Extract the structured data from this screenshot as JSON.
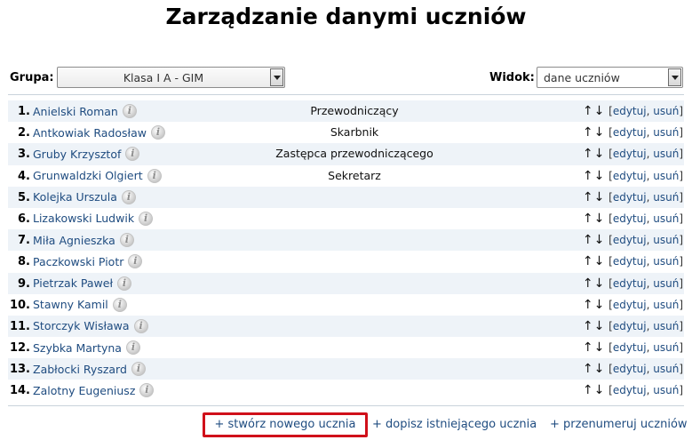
{
  "page": {
    "title": "Zarządzanie danymi uczniów"
  },
  "filters": {
    "group_label": "Grupa:",
    "group_value": "Klasa I A - GIM",
    "view_label": "Widok:",
    "view_value": "dane uczniów"
  },
  "row_actions": {
    "up": "↑",
    "down": "↓",
    "edit": "edytuj",
    "delete": "usuń",
    "separator": ",",
    "open_bracket": "[",
    "close_bracket": "]"
  },
  "info_icon_glyph": "i",
  "students": [
    {
      "num": "1.",
      "name": "Anielski Roman",
      "role": "Przewodniczący"
    },
    {
      "num": "2.",
      "name": "Antkowiak Radosław",
      "role": "Skarbnik"
    },
    {
      "num": "3.",
      "name": "Gruby Krzysztof",
      "role": "Zastępca przewodniczącego"
    },
    {
      "num": "4.",
      "name": "Grunwaldzki Olgiert",
      "role": "Sekretarz"
    },
    {
      "num": "5.",
      "name": "Kolejka Urszula",
      "role": ""
    },
    {
      "num": "6.",
      "name": "Lizakowski Ludwik",
      "role": ""
    },
    {
      "num": "7.",
      "name": "Miła Agnieszka",
      "role": ""
    },
    {
      "num": "8.",
      "name": "Paczkowski Piotr",
      "role": ""
    },
    {
      "num": "9.",
      "name": "Pietrzak Paweł",
      "role": ""
    },
    {
      "num": "10.",
      "name": "Stawny Kamil",
      "role": ""
    },
    {
      "num": "11.",
      "name": "Storczyk Wisława",
      "role": ""
    },
    {
      "num": "12.",
      "name": "Szybka Martyna",
      "role": ""
    },
    {
      "num": "13.",
      "name": "Zabłocki Ryszard",
      "role": ""
    },
    {
      "num": "14.",
      "name": "Zalotny Eugeniusz",
      "role": ""
    }
  ],
  "bottom": {
    "create": "+ stwórz nowego ucznia",
    "attach": "+ dopisz istniejącego ucznia",
    "renumber": "+ przenumeruj uczniów"
  }
}
